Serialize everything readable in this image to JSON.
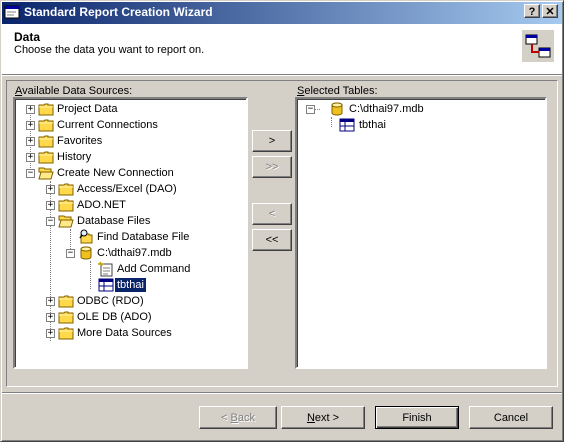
{
  "window": {
    "title": "Standard Report Creation Wizard",
    "help_btn": "?",
    "close_btn": "✕"
  },
  "header": {
    "title": "Data",
    "subtitle": "Choose the data you want to report on."
  },
  "left_panel": {
    "label_prefix": "A",
    "label_rest": "vailable Data Sources:",
    "items": [
      {
        "label": "Project Data",
        "icon": "folder-icon",
        "expander": "+"
      },
      {
        "label": "Current Connections",
        "icon": "folder-icon",
        "expander": "+"
      },
      {
        "label": "Favorites",
        "icon": "folder-icon",
        "expander": "+"
      },
      {
        "label": "History",
        "icon": "folder-icon",
        "expander": "+"
      },
      {
        "label": "Create New Connection",
        "icon": "folder-open-icon",
        "expander": "−"
      },
      {
        "label": "Access/Excel (DAO)",
        "icon": "folder-icon",
        "expander": "+"
      },
      {
        "label": "ADO.NET",
        "icon": "folder-icon",
        "expander": "+"
      },
      {
        "label": "Database Files",
        "icon": "folder-open-icon",
        "expander": "−"
      },
      {
        "label": "Find Database File",
        "icon": "find-database-icon",
        "expander": ""
      },
      {
        "label": "C:\\dthai97.mdb",
        "icon": "database-icon",
        "expander": "−"
      },
      {
        "label": "Add Command",
        "icon": "add-command-icon",
        "expander": ""
      },
      {
        "label": "tbthai",
        "icon": "table-icon",
        "expander": ""
      },
      {
        "label": "ODBC (RDO)",
        "icon": "folder-icon",
        "expander": "+"
      },
      {
        "label": "OLE DB (ADO)",
        "icon": "folder-icon",
        "expander": "+"
      },
      {
        "label": "More Data Sources",
        "icon": "folder-icon",
        "expander": "+"
      }
    ]
  },
  "middle_buttons": {
    "add": ">",
    "add_all": ">>",
    "remove": "<",
    "remove_all": "<<"
  },
  "right_panel": {
    "label_prefix": "S",
    "label_rest": "elected Tables:",
    "items": [
      {
        "label": "C:\\dthai97.mdb",
        "icon": "database-icon",
        "expander": "−"
      },
      {
        "label": "tbthai",
        "icon": "table-icon",
        "expander": ""
      }
    ]
  },
  "footer": {
    "back": "< Back",
    "back_u": "B",
    "next": "Next >",
    "next_u": "N",
    "finish": "Finish",
    "cancel": "Cancel"
  },
  "colors": {
    "title_start": "#0a246a",
    "title_end": "#a6caf0",
    "selection": "#0a246a",
    "folder": "#ffd700"
  }
}
